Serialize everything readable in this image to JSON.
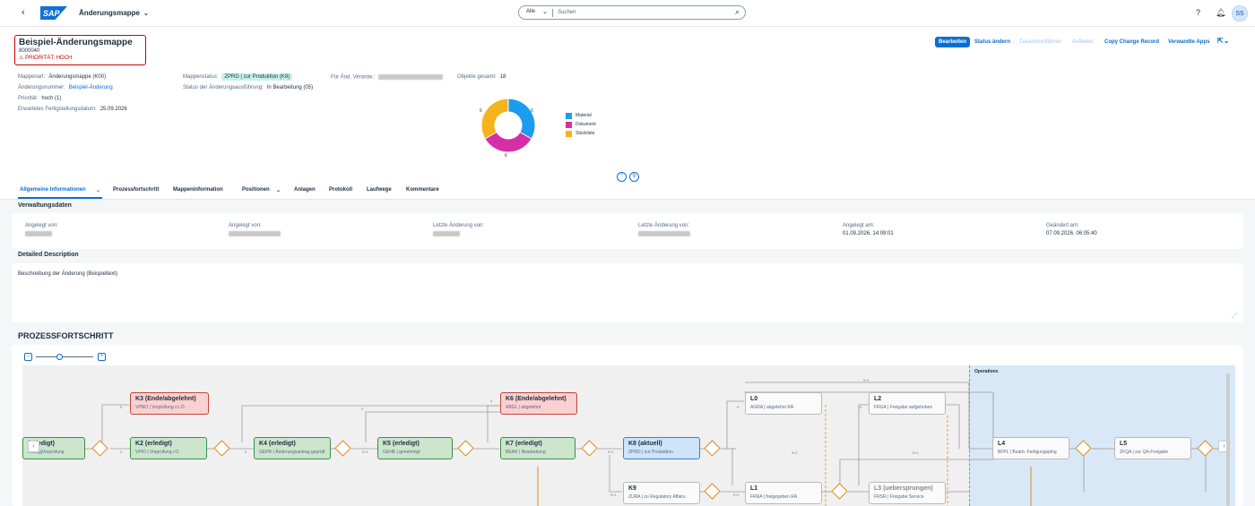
{
  "shell": {
    "back_icon": "back-icon",
    "logo_text": "SAP",
    "app_title": "Änderungsmappe",
    "search_scope": "Alle",
    "search_placeholder": "Suchen",
    "avatar_initials": "SS"
  },
  "object": {
    "title": "Beispiel-Änderungsmappe",
    "number": "8000040",
    "priority_label": "⚠ PRIORITÄT: HOCH"
  },
  "actions": {
    "edit": "Bearbeiten",
    "change_status": "Status ändern",
    "merge": "Zusammenführen",
    "split": "Aufteilen",
    "copy": "Copy Change Record",
    "related_apps": "Verwandte Apps"
  },
  "attributes": {
    "col1": [
      {
        "k": "Mappenart:",
        "v": "Änderungsmappe (K00)"
      },
      {
        "k": "Änderungsnummer:",
        "v": "Beispiel-Änderung"
      },
      {
        "k": "Priorität:",
        "v": "hoch (1)"
      },
      {
        "k": "Erwartetes Fertigstellungsdatum:",
        "v": "25.09.2026"
      }
    ],
    "status_label": "Mappenstatus:",
    "status_value": "ZPRD | zur Produktion (K8)",
    "exec_label": "Status der Änderungsausführung:",
    "exec_value": "In Bearbeitung (05)",
    "responsible_label": "Für Änd. Verantw.:",
    "objects_label": "Objekte gesamt:",
    "objects_value": "18"
  },
  "chart_data": {
    "type": "pie",
    "categories": [
      "Material",
      "Dokument",
      "Stückliste"
    ],
    "values": [
      6,
      6,
      6
    ],
    "colors": [
      "#1b9cf0",
      "#d62ea6",
      "#f5b41d"
    ]
  },
  "tabs": [
    "Allgemeine Informationen",
    "Prozessfortschritt",
    "Mappeninformation",
    "Positionen",
    "Anlagen",
    "Protokoll",
    "Laufwege",
    "Kommentare"
  ],
  "admin": {
    "title": "Verwaltungsdaten",
    "created_by_label": "Angelegt von:",
    "created_by2_label": "Angelegt von:",
    "changed_by_label": "Letzte Änderung von:",
    "changed_by2_label": "Letzte Änderung von:",
    "created_on_label": "Angelegt am:",
    "created_on": "01.09.2026, 14:09:01",
    "changed_on_label": "Geändert am:",
    "changed_on": "07.09.2026, 06:05:40"
  },
  "description": {
    "title": "Detailed Description",
    "text": "Beschreibung der Änderung (Beispieltext)"
  },
  "process": {
    "title": "PROZESSFORTSCHRITT",
    "operations_label": "Operations",
    "nodes": [
      {
        "h": "(erledigt)",
        "s": "Antrag|Vorprüfung"
      },
      {
        "h": "K3 (Ende/abgelehnt)",
        "s": "VPNO | Vorprüfung n.i.O."
      },
      {
        "h": "K2 (erledigt)",
        "s": "VPIO | Vorprüfung i.O."
      },
      {
        "h": "K4 (erledigt)",
        "s": "GEPR | Änderungsantrag geprüft"
      },
      {
        "h": "K5 (erledigt)",
        "s": "GENE | genehmigt"
      },
      {
        "h": "K6 (Ende/abgelehnt)",
        "s": "ABGL | abgelehnt"
      },
      {
        "h": "K7 (erledigt)",
        "s": "BEAR | Bearbeitung"
      },
      {
        "h": "K8 (aktuell)",
        "s": "ZPRD | zur Produktion"
      },
      {
        "h": "K9",
        "s": "ZURA | zu Regulatory Affairs"
      },
      {
        "h": "L0",
        "s": "AGRA | abgelehnt RA"
      },
      {
        "h": "L1",
        "s": "FRRA | freigegeben RA"
      },
      {
        "h": "L2",
        "s": "FRGA | Freigabe aufgehoben"
      },
      {
        "h": "L3 (uebersprungen)",
        "s": "FRSR | Freigabe Service"
      },
      {
        "h": "L4",
        "s": "BFPL | Bearb. Fertigungsplng"
      },
      {
        "h": "L5",
        "s": "ZFQA | zur QA-Freigabe"
      }
    ],
    "edge_labels": [
      "0",
      "2",
      "0",
      "2",
      "5+1",
      "0",
      "5+1",
      "9+1",
      "9+1",
      "5+1",
      "0",
      "9+1",
      "9+1",
      "6"
    ]
  },
  "pie_labels": [
    "6",
    "6",
    "6"
  ]
}
